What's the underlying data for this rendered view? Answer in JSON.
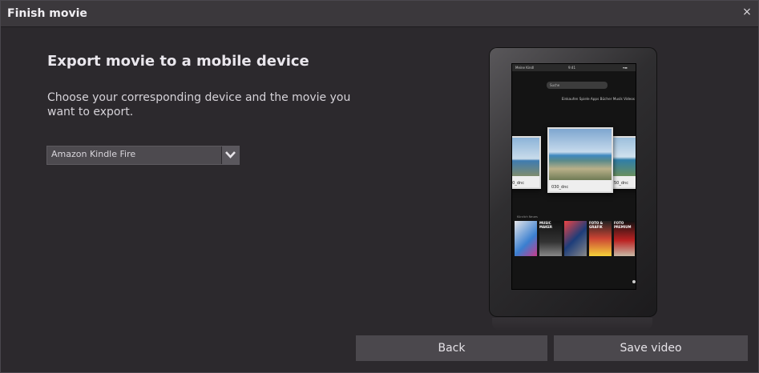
{
  "window": {
    "title": "Finish movie",
    "close_glyph": "×"
  },
  "main": {
    "heading": "Export movie to a mobile device",
    "description": "Choose your corresponding device and the movie you want to export.",
    "device_select": {
      "value": "Amazon Kindle Fire"
    }
  },
  "preview": {
    "status_left": "Meine Kindl",
    "status_time": "9:41",
    "search_placeholder": "Suche",
    "tabs": "Einkaufen  Spiele  Apps  Bücher  Musik  Videos",
    "photos": [
      "50_dnc",
      "030_dnc",
      "50_dnc"
    ],
    "shelf_label": "Kürzlich Neues",
    "books": [
      "",
      "MUSIC MAKER",
      "",
      "FOTO & GRAFIK",
      "FOTO PREMIUM"
    ]
  },
  "footer": {
    "back_label": "Back",
    "save_label": "Save video"
  },
  "colors": {
    "background": "#2c292d",
    "titlebar": "#3b383c",
    "button": "#4b484d"
  }
}
